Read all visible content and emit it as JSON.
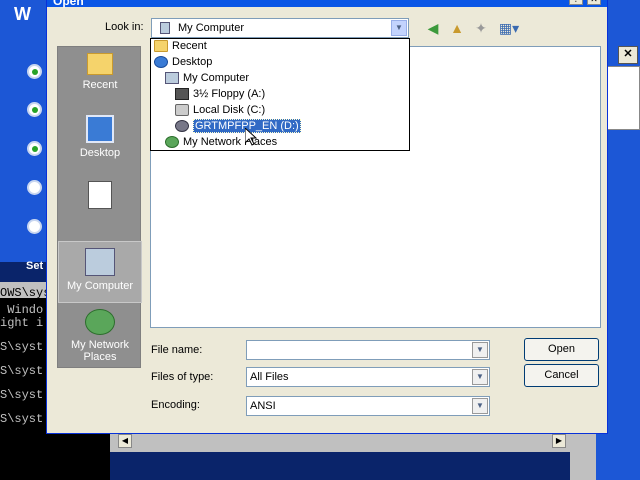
{
  "background": {
    "logo_text": "W",
    "setup_label": "Set",
    "console_lines": [
      "OWS\\sys",
      " Windo",
      "ight i",
      "",
      "S\\syst",
      "",
      "S\\syst",
      "",
      "S\\syst",
      "",
      "S\\syst"
    ],
    "close_glyph": "✕"
  },
  "dialog": {
    "title": "Open",
    "look_in": {
      "label": "Look in:",
      "value": "My Computer"
    },
    "dropdown_items": [
      {
        "label": "Recent",
        "icon": "folder-icon"
      },
      {
        "label": "Desktop",
        "icon": "desktop-icon"
      },
      {
        "label": "My Computer",
        "icon": "computer-icon"
      },
      {
        "label": "3½ Floppy (A:)",
        "icon": "floppy-icon"
      },
      {
        "label": "Local Disk (C:)",
        "icon": "hard-disk-icon"
      },
      {
        "label": "GRTMPFPP_EN (D:)",
        "icon": "cdrom-icon",
        "selected": true
      },
      {
        "label": "My Network Places",
        "icon": "network-icon"
      }
    ],
    "places": [
      {
        "label": "Recent",
        "icon": "recent-folder-icon"
      },
      {
        "label": "Desktop",
        "icon": "desktop-icon"
      },
      {
        "label": "",
        "icon": "document-icon"
      },
      {
        "label": "My Computer",
        "icon": "my-computer-icon",
        "selected": true
      },
      {
        "label": "My Network Places",
        "icon": "network-places-icon"
      }
    ],
    "file_name": {
      "label": "File name:",
      "value": ""
    },
    "files_of_type": {
      "label": "Files of type:",
      "value": "All Files"
    },
    "encoding": {
      "label": "Encoding:",
      "value": "ANSI"
    },
    "open_button": "Open",
    "cancel_button": "Cancel"
  }
}
